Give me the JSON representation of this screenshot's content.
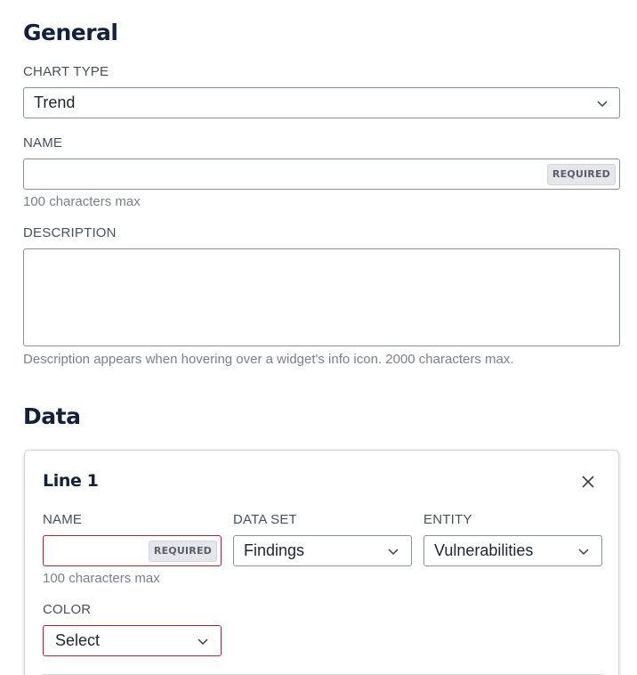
{
  "general": {
    "title": "General",
    "chart_type": {
      "label": "CHART TYPE",
      "value": "Trend"
    },
    "name": {
      "label": "NAME",
      "value": "",
      "badge": "REQUIRED",
      "hint": "100 characters max"
    },
    "description": {
      "label": "DESCRIPTION",
      "value": "",
      "hint": "Description appears when hovering over a widget's info icon. 2000 characters max."
    }
  },
  "data": {
    "title": "Data",
    "line": {
      "title": "Line 1",
      "name": {
        "label": "NAME",
        "value": "",
        "badge": "REQUIRED",
        "hint": "100 characters max"
      },
      "data_set": {
        "label": "DATA SET",
        "value": "Findings"
      },
      "entity": {
        "label": "ENTITY",
        "value": "Vulnerabilities"
      },
      "color": {
        "label": "COLOR",
        "value": "Select"
      }
    }
  },
  "icons": {
    "chevron": "chevron-down-icon",
    "close": "close-icon"
  },
  "colors": {
    "heading": "#14213d",
    "error_border": "#a82a3a",
    "badge_bg": "#e4e6ea"
  }
}
